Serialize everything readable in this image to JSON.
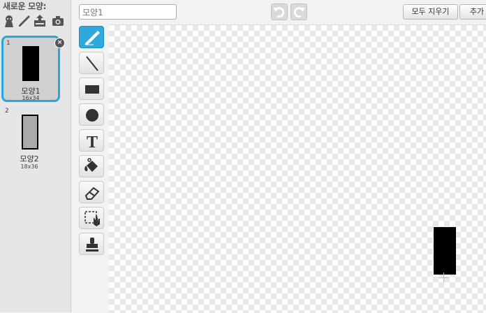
{
  "new_costume": {
    "label": "새로운 모양:",
    "icons": [
      "paint-sprite-icon",
      "paintbrush-icon",
      "upload-icon",
      "camera-icon"
    ]
  },
  "costumes": [
    {
      "number": "1",
      "name": "모양1",
      "size": "16x34",
      "selected": true
    },
    {
      "number": "2",
      "name": "모양2",
      "size": "18x36",
      "selected": false
    }
  ],
  "editor": {
    "costume_name_value": "모양1",
    "clear_label": "모두 지우기",
    "add_label": "추가"
  },
  "tools": [
    "brush-tool-icon",
    "line-tool-icon",
    "rectangle-tool-icon",
    "ellipse-tool-icon",
    "text-tool-icon",
    "fill-tool-icon",
    "eraser-tool-icon",
    "select-tool-icon",
    "stamp-tool-icon"
  ],
  "text_tool_glyph": "T",
  "colors": {
    "accent": "#27a6dd",
    "active_tool": "#2fa9dc"
  }
}
